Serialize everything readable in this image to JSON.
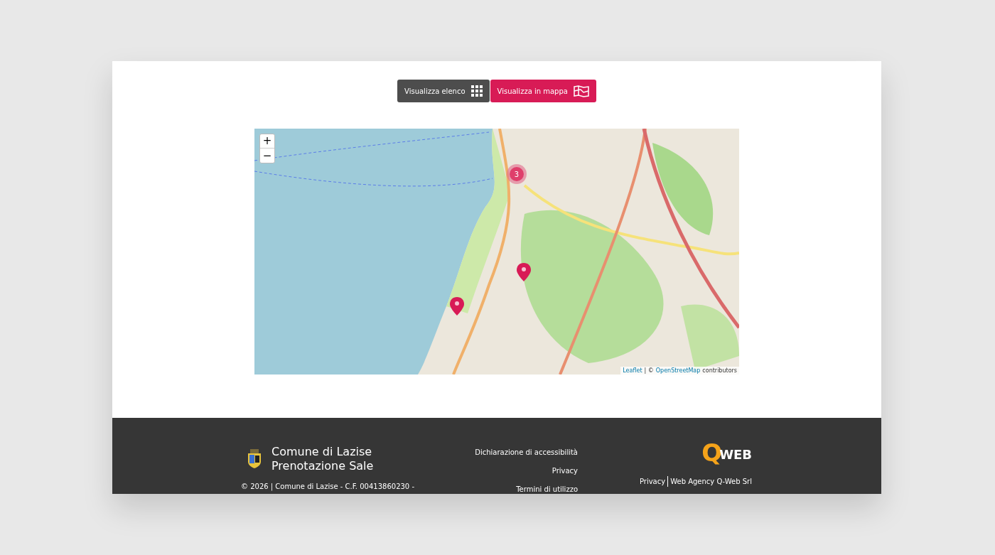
{
  "view_buttons": [
    {
      "label": "Visualizza elenco",
      "kind": "list",
      "selected": false
    },
    {
      "label": "Visualizza in mappa",
      "kind": "map",
      "selected": true
    }
  ],
  "map": {
    "zoom_in": "+",
    "zoom_out": "−",
    "cluster_count": "3",
    "attribution": [
      {
        "kind": "link",
        "text": "Leaflet"
      },
      {
        "kind": "text",
        "text": "| ©"
      },
      {
        "kind": "link",
        "text": "OpenStreetMap"
      },
      {
        "kind": "text",
        "text": "contributors"
      }
    ]
  },
  "footer": {
    "title_lines": [
      "Comune di Lazise",
      "Prenotazione Sale"
    ],
    "copyright": "© 2026 | Comune di Lazise - C.F. 00413860230 -",
    "links": [
      "Dichiarazione di accessibilità",
      "Privacy",
      "Termini di utilizzo"
    ],
    "agency_logo": {
      "letter": "Q",
      "word": "WEB"
    },
    "agency_links": [
      "Privacy",
      "Web Agency Q-Web Srl"
    ]
  }
}
